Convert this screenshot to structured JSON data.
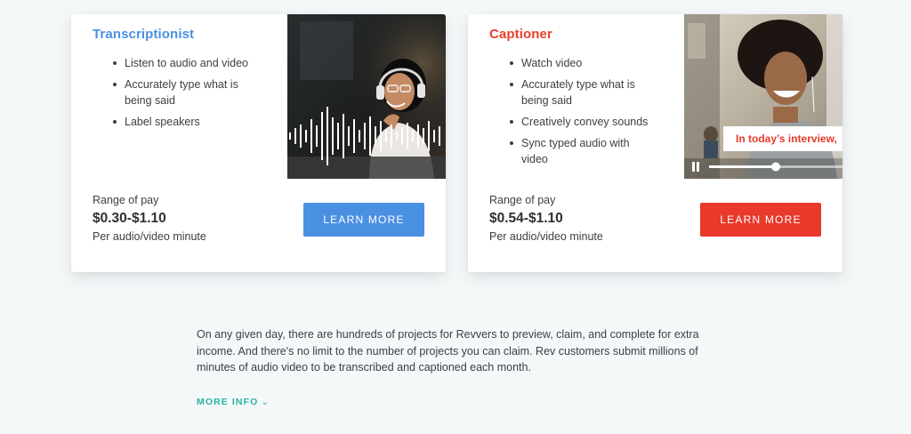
{
  "colors": {
    "background": "#f4f8f9",
    "transcriptionist_accent": "#4a90e2",
    "captioner_accent": "#e8392a",
    "more_info": "#2bb3a3"
  },
  "cards": [
    {
      "title": "Transcriptionist",
      "duties": [
        "Listen to audio and video",
        "Accurately type what is being said",
        "Label speakers"
      ],
      "pay_label": "Range of pay",
      "pay_range": "$0.30-$1.10",
      "pay_unit": "Per audio/video minute",
      "button_label": "LEARN MORE",
      "image": {
        "icon": "soundwave-icon"
      }
    },
    {
      "title": "Captioner",
      "duties": [
        "Watch video",
        "Accurately type what is being said",
        "Creatively convey sounds",
        "Sync typed audio with video"
      ],
      "pay_label": "Range of pay",
      "pay_range": "$0.54-$1.10",
      "pay_unit": "Per audio/video minute",
      "button_label": "LEARN MORE",
      "image": {
        "caption_text": "In today’s interview,",
        "icon": "pause-icon",
        "progress": 0.5
      }
    }
  ],
  "description": "On any given day, there are hundreds of projects for Revvers to preview, claim, and complete for extra income. And there's no limit to the number of projects you can claim. Rev customers submit millions of minutes of audio video to be transcribed and captioned each month.",
  "more_info": {
    "label": "MORE INFO",
    "icon": "chevron-down-icon"
  }
}
